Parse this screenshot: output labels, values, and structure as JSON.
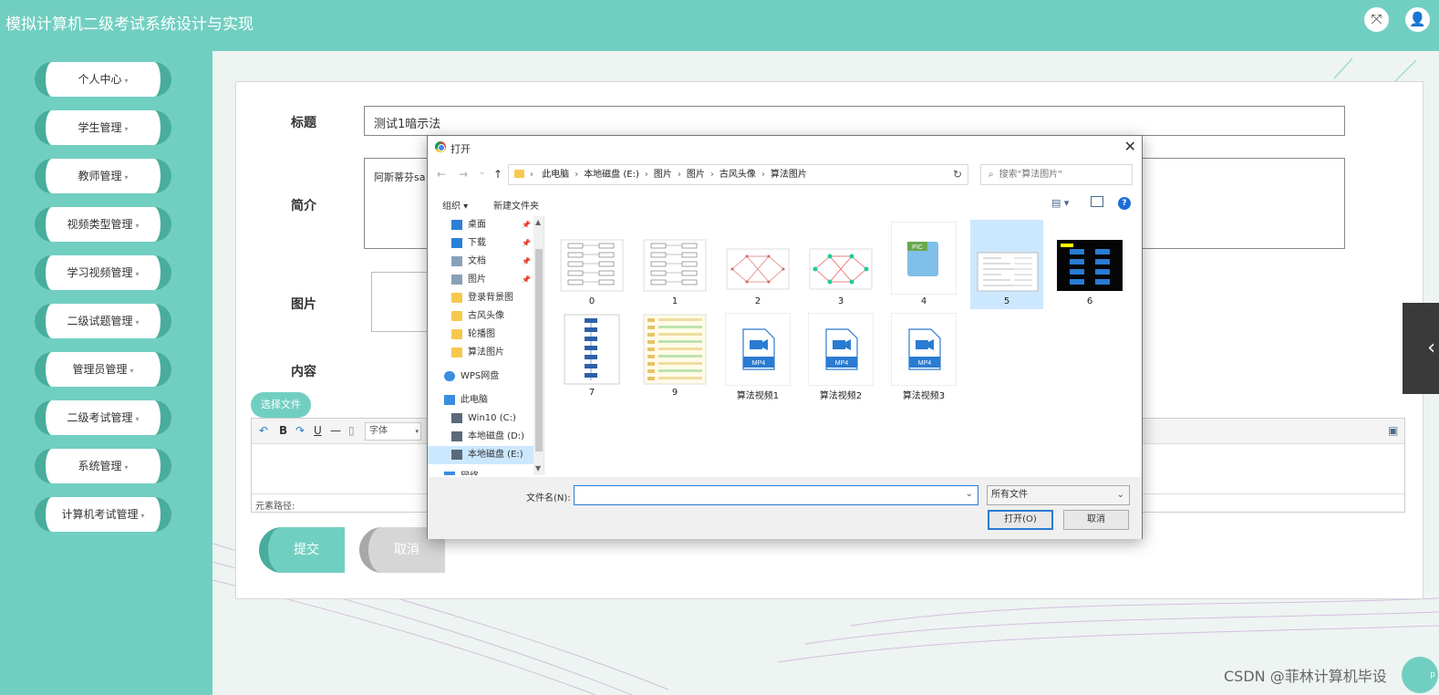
{
  "header": {
    "title": "模拟计算机二级考试系统设计与实现",
    "fullscreen_icon": "⤧",
    "user_icon": "👤"
  },
  "sidebar": {
    "items": [
      {
        "label": "个人中心"
      },
      {
        "label": "学生管理"
      },
      {
        "label": "教师管理"
      },
      {
        "label": "视频类型管理"
      },
      {
        "label": "学习视频管理"
      },
      {
        "label": "二级试题管理"
      },
      {
        "label": "管理员管理"
      },
      {
        "label": "二级考试管理"
      },
      {
        "label": "系统管理"
      },
      {
        "label": "计算机考试管理"
      }
    ]
  },
  "form": {
    "title_label": "标题",
    "title_value": "测试1暗示法",
    "intro_label": "简介",
    "intro_value": "阿斯蒂芬sa",
    "image_label": "图片",
    "content_label": "内容",
    "choose_file": "选择文件",
    "editor": {
      "font_select": "字体",
      "path_label": "元素路径:"
    },
    "submit": "提交",
    "cancel": "取消"
  },
  "watermark": "CSDN @菲林计算机毕设",
  "corner_badge": "p",
  "dialog": {
    "title": "打开",
    "close": "✕",
    "nav": {
      "back": "←",
      "forward": "→",
      "recent": "⌄",
      "up": "↑"
    },
    "path": [
      "此电脑",
      "本地磁盘 (E:)",
      "图片",
      "图片",
      "古风头像",
      "算法图片"
    ],
    "search_placeholder": "搜索\"算法图片\"",
    "toolbar": {
      "organize": "组织 ▾",
      "new_folder": "新建文件夹",
      "help": "?"
    },
    "nav_pane": [
      {
        "label": "桌面",
        "icon": "desktop-icon",
        "color": "#2c7fd6",
        "pinned": true
      },
      {
        "label": "下载",
        "icon": "download-icon",
        "color": "#2c7fd6",
        "pinned": true
      },
      {
        "label": "文档",
        "icon": "document-icon",
        "color": "#8aa0b8",
        "pinned": true
      },
      {
        "label": "图片",
        "icon": "pictures-icon",
        "color": "#8aa0b8",
        "pinned": true
      },
      {
        "label": "登录背景图",
        "icon": "folder-icon",
        "color": "#f6c94e"
      },
      {
        "label": "古风头像",
        "icon": "folder-icon",
        "color": "#f6c94e"
      },
      {
        "label": "轮播图",
        "icon": "folder-icon",
        "color": "#f6c94e"
      },
      {
        "label": "算法图片",
        "icon": "folder-icon",
        "color": "#f6c94e"
      },
      {
        "label": "WPS网盘",
        "icon": "cloud-icon",
        "color": "#3b8de0"
      },
      {
        "label": "此电脑",
        "icon": "pc-icon",
        "color": "#3b8de0"
      },
      {
        "label": "Win10 (C:)",
        "icon": "drive-icon",
        "color": "#5a6a7a"
      },
      {
        "label": "本地磁盘 (D:)",
        "icon": "drive-icon",
        "color": "#5a6a7a"
      },
      {
        "label": "本地磁盘 (E:)",
        "icon": "drive-icon",
        "color": "#5a6a7a",
        "selected": true
      },
      {
        "label": "网络",
        "icon": "network-icon",
        "color": "#3b8de0"
      }
    ],
    "files": [
      {
        "name": "0",
        "kind": "flowchart"
      },
      {
        "name": "1",
        "kind": "flowchart"
      },
      {
        "name": "2",
        "kind": "graph"
      },
      {
        "name": "3",
        "kind": "graph-color"
      },
      {
        "name": "4",
        "kind": "pic"
      },
      {
        "name": "5",
        "kind": "doc",
        "selected": true
      },
      {
        "name": "6",
        "kind": "dark"
      },
      {
        "name": "7",
        "kind": "flow-tall"
      },
      {
        "name": "9",
        "kind": "table"
      },
      {
        "name": "算法视频1",
        "kind": "mp4"
      },
      {
        "name": "算法视频2",
        "kind": "mp4"
      },
      {
        "name": "算法视频3",
        "kind": "mp4"
      }
    ],
    "filename_label": "文件名(N):",
    "filename_value": "",
    "filetype": "所有文件",
    "open": "打开(O)",
    "cancel": "取消",
    "mp4_label": "MP4",
    "pic_label": "PIC"
  }
}
